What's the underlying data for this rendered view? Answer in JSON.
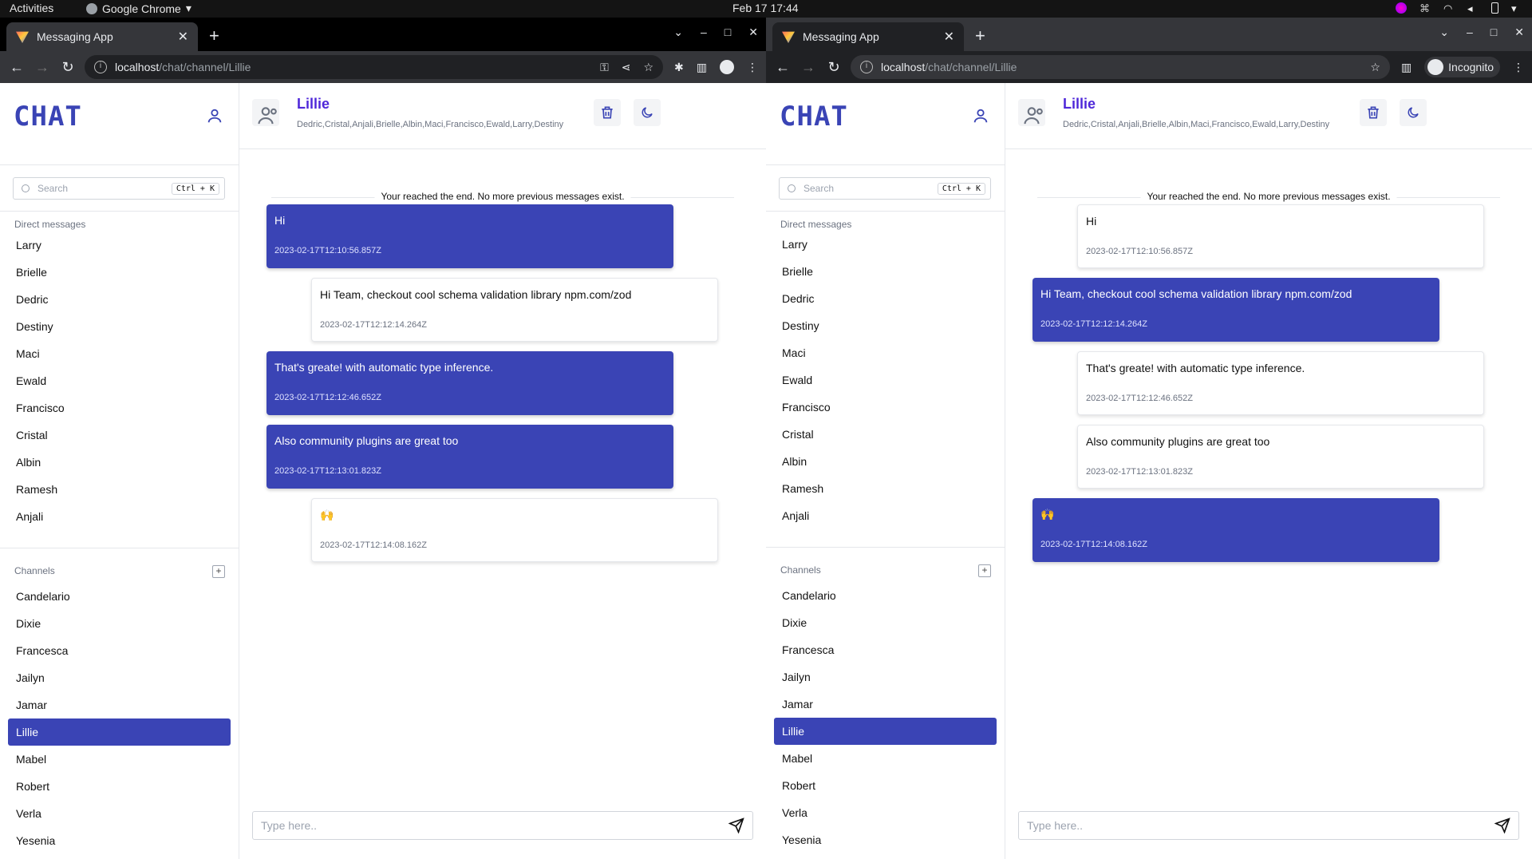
{
  "os": {
    "activities": "Activities",
    "app_name": "Google Chrome",
    "datetime": "Feb 17  17:44"
  },
  "windows": [
    {
      "tab_title": "Messaging App",
      "url_host": "localhost",
      "url_path": "/chat/channel/Lillie",
      "incognito_label": ""
    },
    {
      "tab_title": "Messaging App",
      "url_host": "localhost",
      "url_path": "/chat/channel/Lillie",
      "incognito_label": "Incognito"
    }
  ],
  "app": {
    "logo": "CHAT",
    "search_placeholder": "Search",
    "search_shortcut": "Ctrl + K",
    "dm_label": "Direct messages",
    "direct_messages": [
      "Larry",
      "Brielle",
      "Dedric",
      "Destiny",
      "Maci",
      "Ewald",
      "Francisco",
      "Cristal",
      "Albin",
      "Ramesh",
      "Anjali"
    ],
    "channels_label": "Channels",
    "add_channel": "+",
    "channels": [
      "Candelario",
      "Dixie",
      "Francesca",
      "Jailyn",
      "Jamar",
      "Lillie",
      "Mabel",
      "Robert",
      "Verla",
      "Yesenia"
    ],
    "active_channel": "Lillie",
    "channel_name": "Lillie",
    "members": "Dedric,Cristal,Anjali,Brielle,Albin,Maci,Francisco,Ewald,Larry,Destiny",
    "end_note": "Your reached the end. No more previous messages exist.",
    "compose_placeholder": "Type here..",
    "messages": [
      {
        "text": "Hi",
        "time": "2023-02-17T12:10:56.857Z"
      },
      {
        "text": "Hi Team, checkout cool schema validation library npm.com/zod",
        "time": "2023-02-17T12:12:14.264Z"
      },
      {
        "text": "That's greate! with automatic type inference.",
        "time": "2023-02-17T12:12:46.652Z"
      },
      {
        "text": "Also community plugins are great too",
        "time": "2023-02-17T12:13:01.823Z"
      },
      {
        "text": "🙌",
        "time": "2023-02-17T12:14:08.162Z"
      }
    ]
  }
}
